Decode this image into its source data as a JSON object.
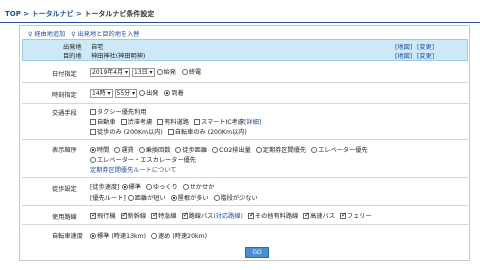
{
  "breadcrumb": {
    "top": "TOP",
    "sep1": " > ",
    "nav": "トータルナビ",
    "sep2": " > ",
    "current": "トータルナビ条件設定"
  },
  "add_links": {
    "waypoint": "経由地追加",
    "od_entry": "出発地と目的地を入替"
  },
  "od": {
    "origin_label": "出発地",
    "origin_value": "自宅",
    "dest_label": "目的地",
    "dest_value": "神田神社(神田明神)",
    "map_label": "[地図]",
    "change_label": "[変更]"
  },
  "date": {
    "label": "日付指定",
    "month": "2019年4月",
    "day": "13日",
    "opt_depart": "始発",
    "opt_last": "終電"
  },
  "time": {
    "label": "時刻指定",
    "hour": "14時",
    "minute": "55分",
    "opt_depart": "出発",
    "opt_arrive": "到着"
  },
  "transport": {
    "label": "交通手段",
    "taxi": "タクシー優先利用",
    "car": "自動車",
    "traffic": "渋滞考慮",
    "toll": "有料道路",
    "smart_ic": "スマートIC考慮",
    "detail": "[詳細]",
    "walk_only": "徒歩のみ (200Km以内)",
    "bike_only": "自転車のみ (200Km以内)"
  },
  "order": {
    "label": "表示順序",
    "opt1": "時間",
    "opt2": "運賃",
    "opt3": "乗換回数",
    "opt4": "徒歩距離",
    "opt5": "CO2排出量",
    "opt6": "定期券区間優先",
    "opt7": "エレベーター優先",
    "opt8": "エレベーター・エスカレーター優先",
    "note": "定期券区間優先ルートについて"
  },
  "walk": {
    "label": "徒歩設定",
    "speed_label": "[徒歩速度]",
    "speed1": "標準",
    "speed2": "ゆっくり",
    "speed3": "せかせか",
    "route_label": "[優先ルート]",
    "route1": "距離が短い",
    "route2": "屋根が多い",
    "route3": "階段が少ない"
  },
  "routes": {
    "label": "使用路線",
    "r1": "飛行機",
    "r2": "新幹線",
    "r3": "特急線",
    "r4": "路線バス",
    "r4_link": "(対応路線)",
    "r5": "その他有料路線",
    "r6": "高速バス",
    "r7": "フェリー"
  },
  "bike": {
    "label": "自転車速度",
    "opt1": "標準 (時速13km)",
    "opt2": "速め (時速20km)"
  },
  "go_label": "GO"
}
